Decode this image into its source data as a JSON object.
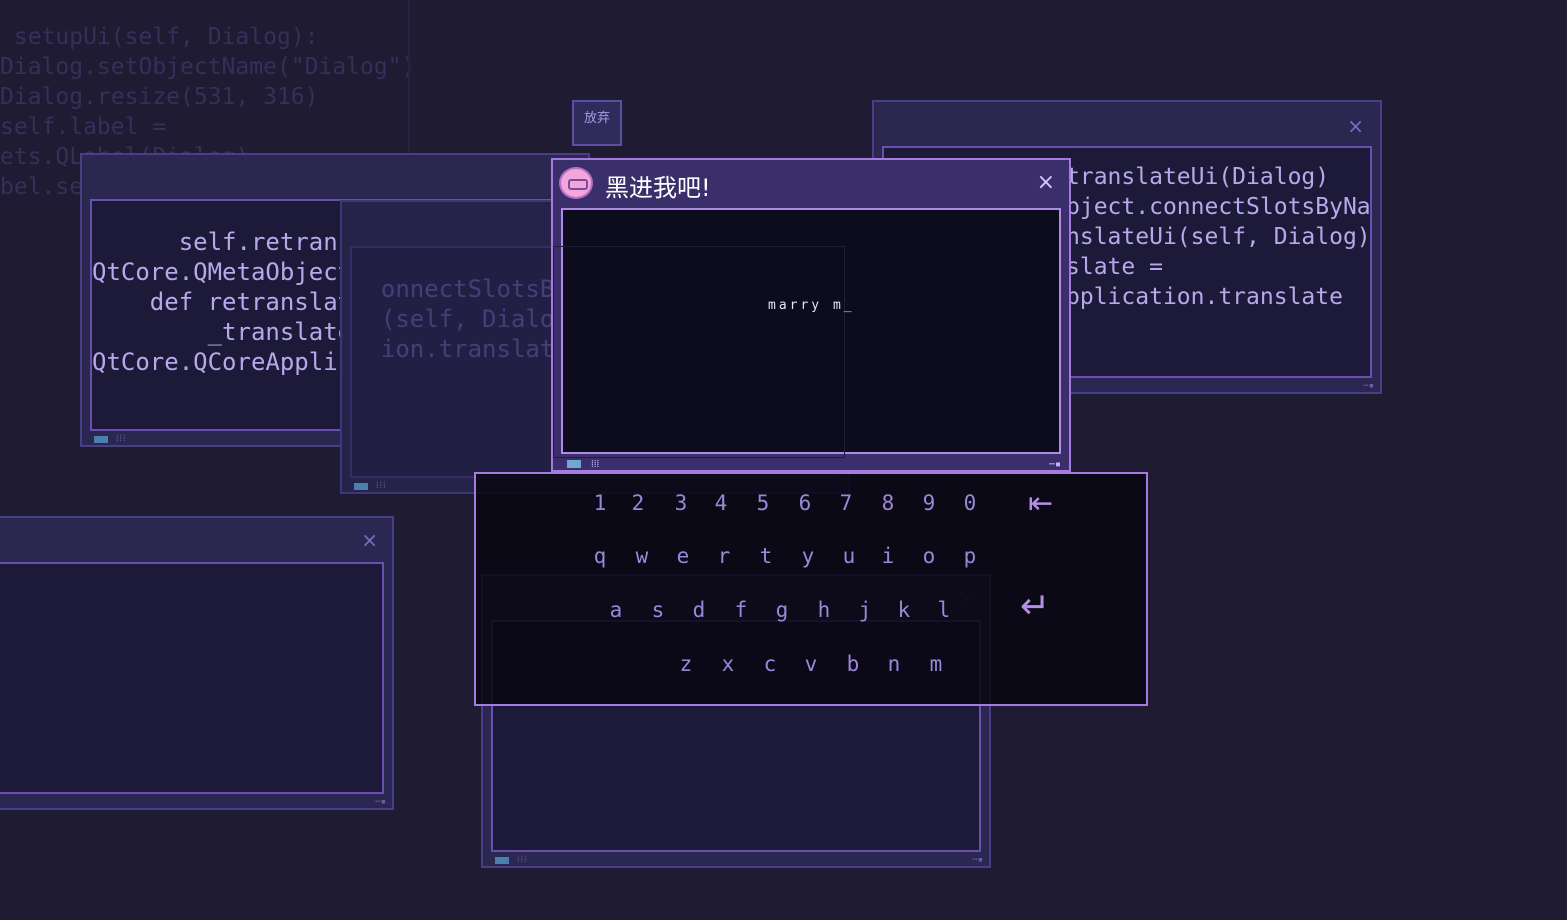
{
  "background_code": [
    " setupUi(self, Dialog):",
    "Dialog.setObjectName(\"Dialog\")",
    "Dialog.resize(531, 316)",
    "self.label =",
    "ets.QLabel(Dialog)",
    "",
    "bel.setGeometry(QtCore.QRect(7"
  ],
  "windows": {
    "left_top": {
      "lines": [
        "      self.retransl",
        "",
        "QtCore.QMetaObject.",
        "",
        "    def retranslateU",
        "        _translate =",
        "QtCore.QCoreApplicat"
      ]
    },
    "mid_back": {
      "lines": [
        "",
        "",
        "  onnectSlotsByNam",
        "",
        "  (self, Dialog):",
        "",
        "  ion.translate"
      ],
      "close": "×"
    },
    "right": {
      "close": "×",
      "lines": [
        "      self.retranslateUi(Dialog)",
        "",
        "QtCore.QMetaObject.connectSlotsByNam",
        "",
        "    def retranslateUi(self, Dialog):",
        "        _translate =",
        "QtCore.QCoreApplication.translate"
      ]
    },
    "left_bottom": {
      "close": "×"
    },
    "bottom_center": {
      "close": "×"
    }
  },
  "giveup_button": "放弃",
  "main_window": {
    "title": "黑进我吧!",
    "close": "×",
    "typed_text": "marry m_"
  },
  "keyboard": {
    "row1": [
      "1",
      "2",
      "3",
      "4",
      "5",
      "6",
      "7",
      "8",
      "9",
      "0"
    ],
    "row2": [
      "q",
      "w",
      "e",
      "r",
      "t",
      "y",
      "u",
      "i",
      "o",
      "p"
    ],
    "row3": [
      "a",
      "s",
      "d",
      "f",
      "g",
      "h",
      "j",
      "k",
      "l"
    ],
    "row4": [
      "z",
      "x",
      "c",
      "v",
      "b",
      "n",
      "m"
    ],
    "backspace_icon": "⇤",
    "enter_icon": "↵"
  },
  "colors": {
    "background": "#1e1b33",
    "accent": "#a67bdf",
    "key_text": "#9b87d8"
  }
}
